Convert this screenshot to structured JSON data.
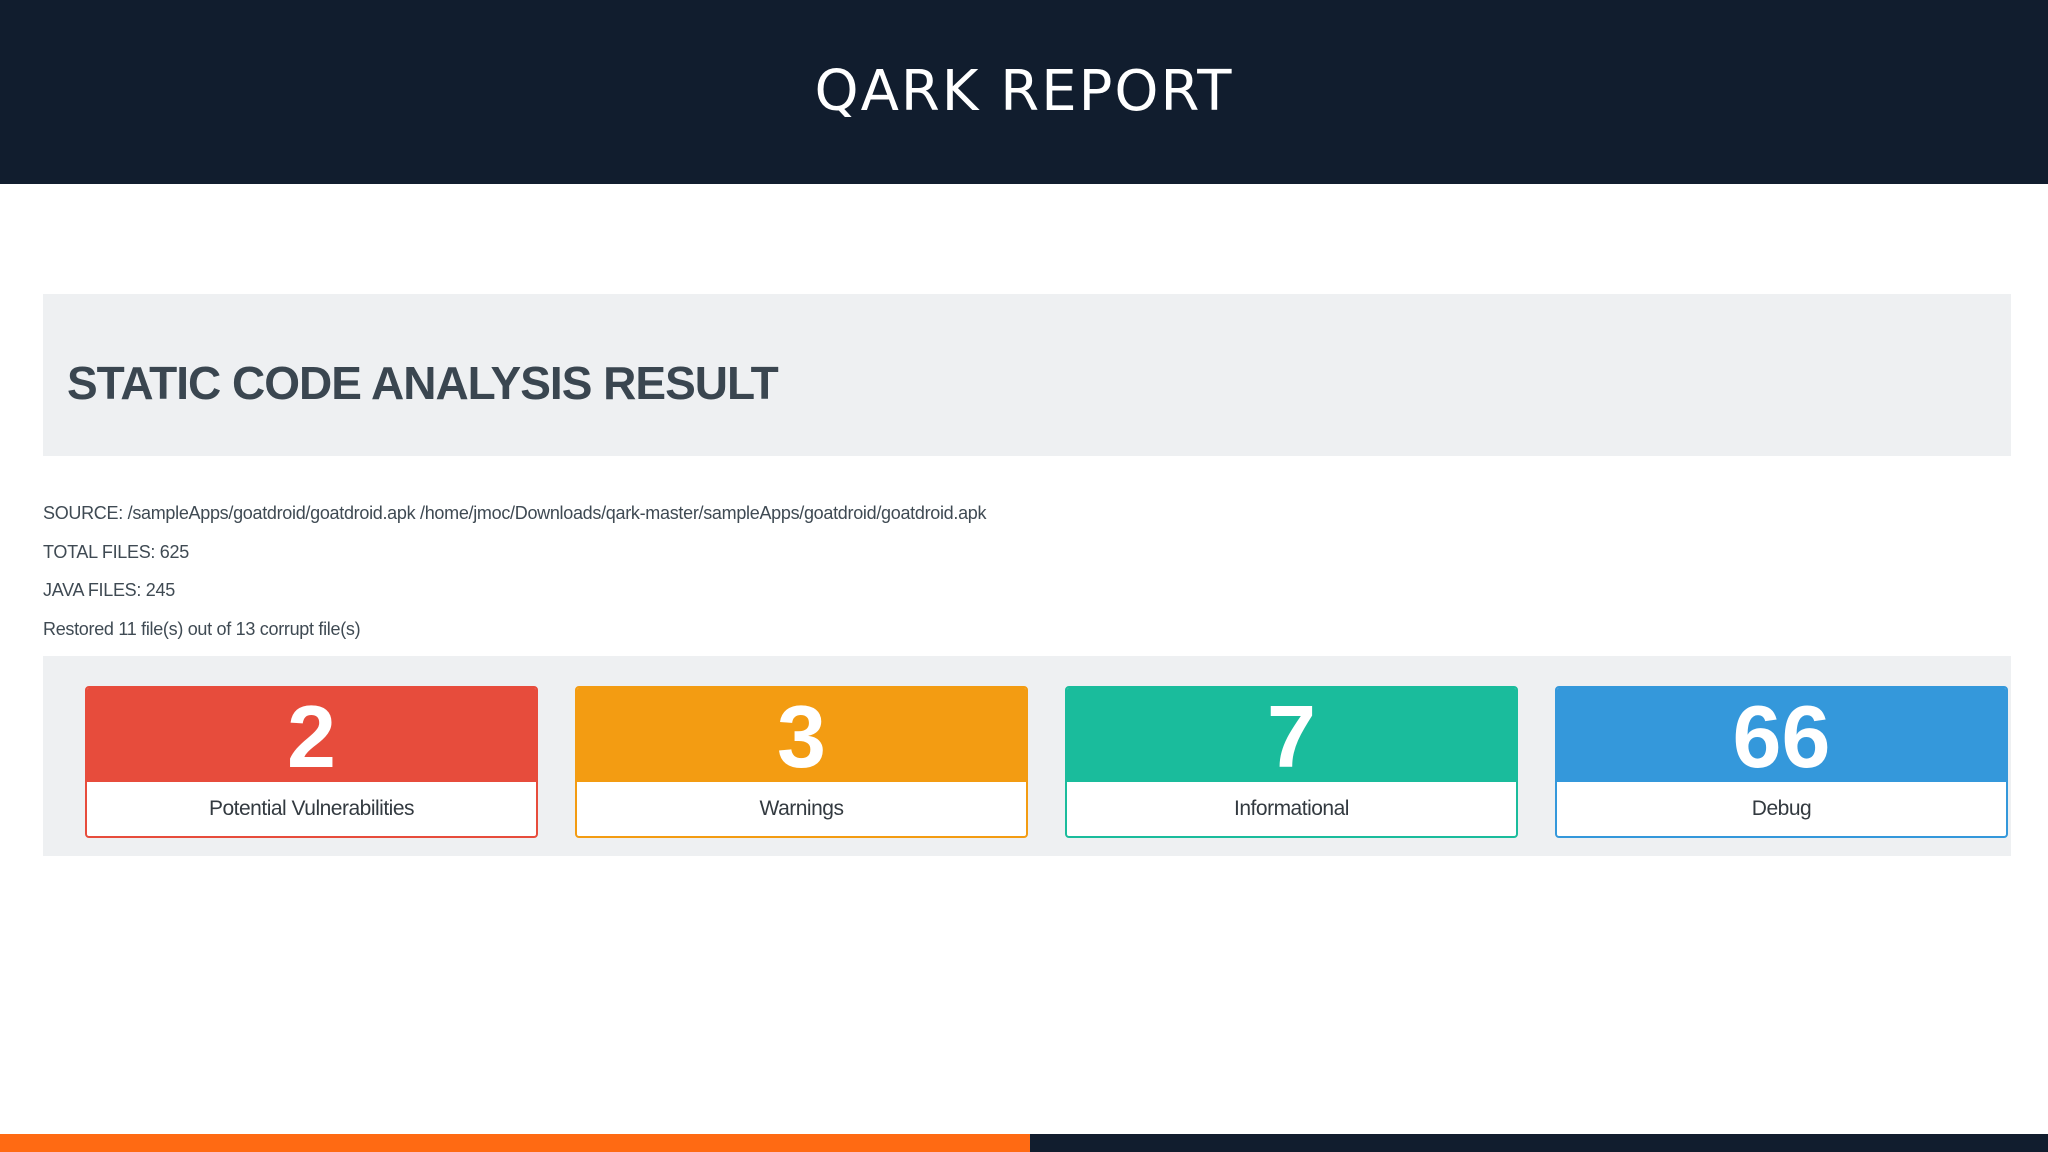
{
  "header": {
    "title": "QARK REPORT"
  },
  "result": {
    "heading": "STATIC CODE ANALYSIS RESULT"
  },
  "info": {
    "source": "SOURCE: /sampleApps/goatdroid/goatdroid.apk /home/jmoc/Downloads/qark-master/sampleApps/goatdroid/goatdroid.apk",
    "total_files": "TOTAL FILES: 625",
    "java_files": "JAVA FILES: 245",
    "restored": "Restored 11 file(s) out of 13 corrupt file(s)"
  },
  "cards": [
    {
      "count": "2",
      "label": "Potential Vulnerabilities",
      "color": "#e74c3c"
    },
    {
      "count": "3",
      "label": "Warnings",
      "color": "#f39c12"
    },
    {
      "count": "7",
      "label": "Informational",
      "color": "#1abc9c"
    },
    {
      "count": "66",
      "label": "Debug",
      "color": "#3498db"
    }
  ],
  "colors": {
    "header_bg": "#111d2e",
    "footer_accent": "#ff6a13",
    "footer_dark": "#111d2e",
    "panel_bg": "#eef0f2"
  }
}
